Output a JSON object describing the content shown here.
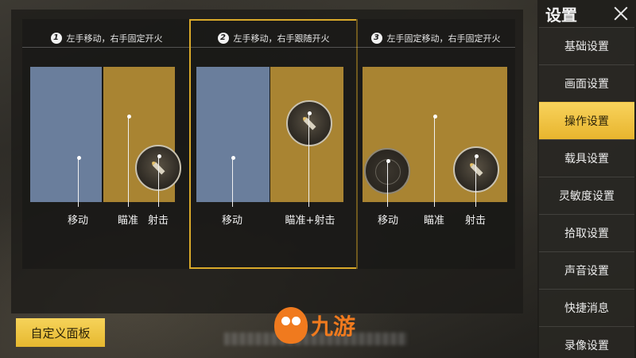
{
  "options": [
    {
      "number": "1",
      "title": "左手移动，右手固定开火",
      "labels": [
        "移动",
        "瞄准",
        "射击"
      ]
    },
    {
      "number": "2",
      "title": "左手移动，右手跟随开火",
      "labels": [
        "移动",
        "瞄准+射击"
      ],
      "selected": true
    },
    {
      "number": "3",
      "title": "左手固定移动，右手固定开火",
      "labels": [
        "移动",
        "瞄准",
        "射击"
      ]
    }
  ],
  "custom_panel_button": "自定义面板",
  "sidebar": {
    "title": "设置",
    "items": [
      {
        "label": "基础设置"
      },
      {
        "label": "画面设置"
      },
      {
        "label": "操作设置",
        "active": true
      },
      {
        "label": "载具设置"
      },
      {
        "label": "灵敏度设置"
      },
      {
        "label": "拾取设置"
      },
      {
        "label": "声音设置"
      },
      {
        "label": "快捷消息"
      },
      {
        "label": "录像设置"
      }
    ]
  },
  "watermark": {
    "text": "九游"
  },
  "colors": {
    "accent": "#e8b52e",
    "move_zone": "#6a7e9c",
    "aim_zone": "#a98432",
    "selected_border": "#d9a92a"
  },
  "icons": [
    "close-icon",
    "bullet-icon",
    "joystick-icon"
  ]
}
